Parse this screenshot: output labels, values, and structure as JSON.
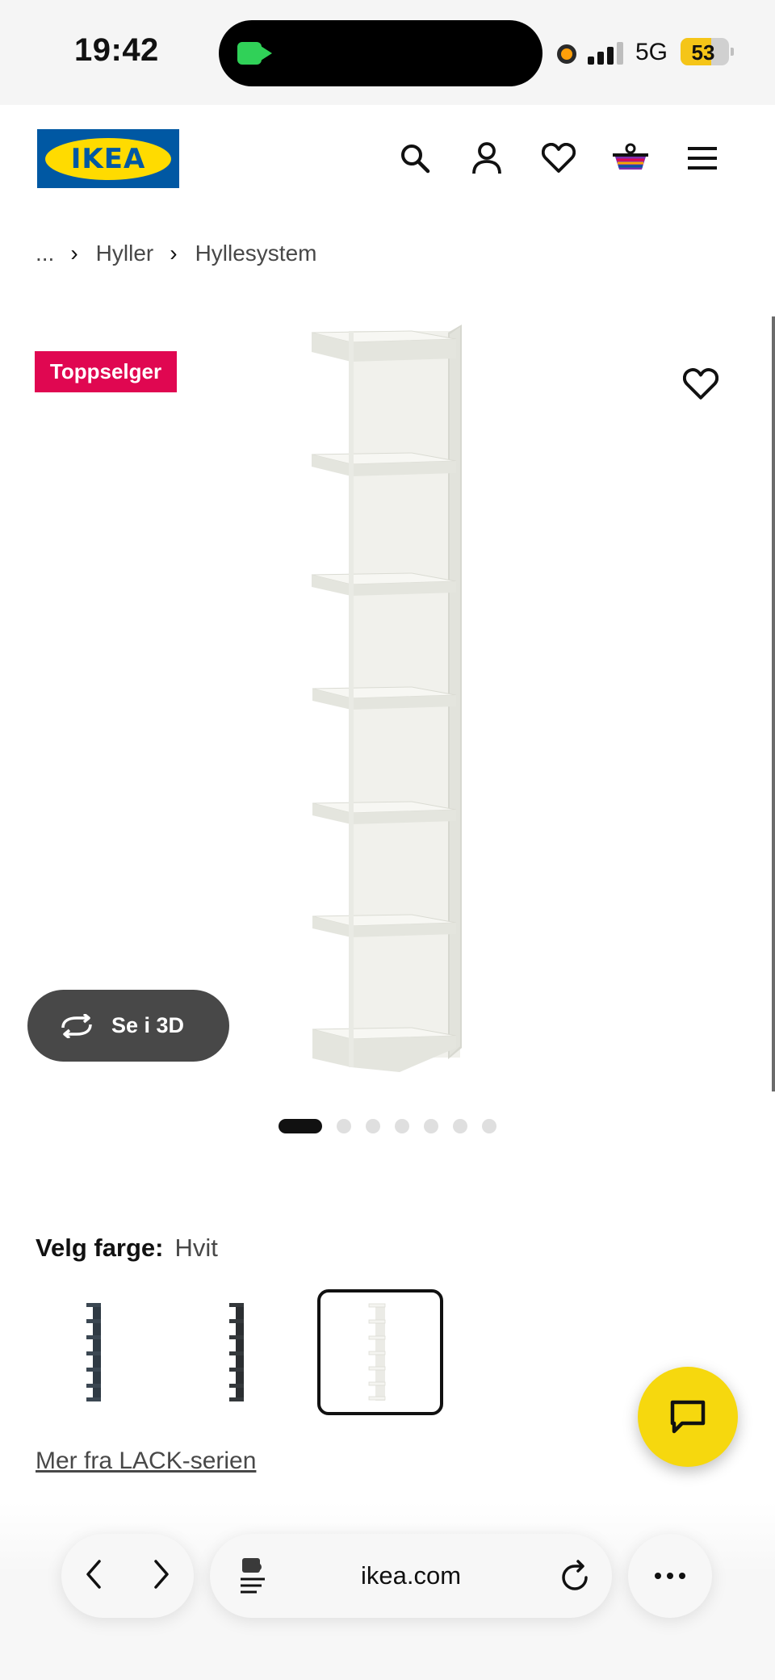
{
  "status_bar": {
    "time": "19:42",
    "network": "5G",
    "battery": "53"
  },
  "header": {
    "logo_text": "IKEA",
    "icons": [
      "search-icon",
      "account-icon",
      "wishlist-icon",
      "cart-icon",
      "menu-icon"
    ]
  },
  "breadcrumb": {
    "ellipsis": "...",
    "items": [
      "Hyller",
      "Hyllesystem"
    ]
  },
  "gallery": {
    "badge": "Toppselger",
    "view_3d_label": "Se i 3D",
    "dot_count": 7,
    "active_dot": 1
  },
  "color_picker": {
    "label": "Velg farge:",
    "selected": "Hvit",
    "swatches": [
      {
        "color": "#2f3a44"
      },
      {
        "color": "#2b2e31"
      },
      {
        "color": "#f3f2ee"
      }
    ]
  },
  "series_link": "Mer fra LACK-serien",
  "browser": {
    "url": "ikea.com"
  },
  "colors": {
    "ikea_blue": "#0058a3",
    "ikea_yellow": "#ffdb00",
    "badge": "#e00751",
    "chat": "#f6d80e"
  }
}
